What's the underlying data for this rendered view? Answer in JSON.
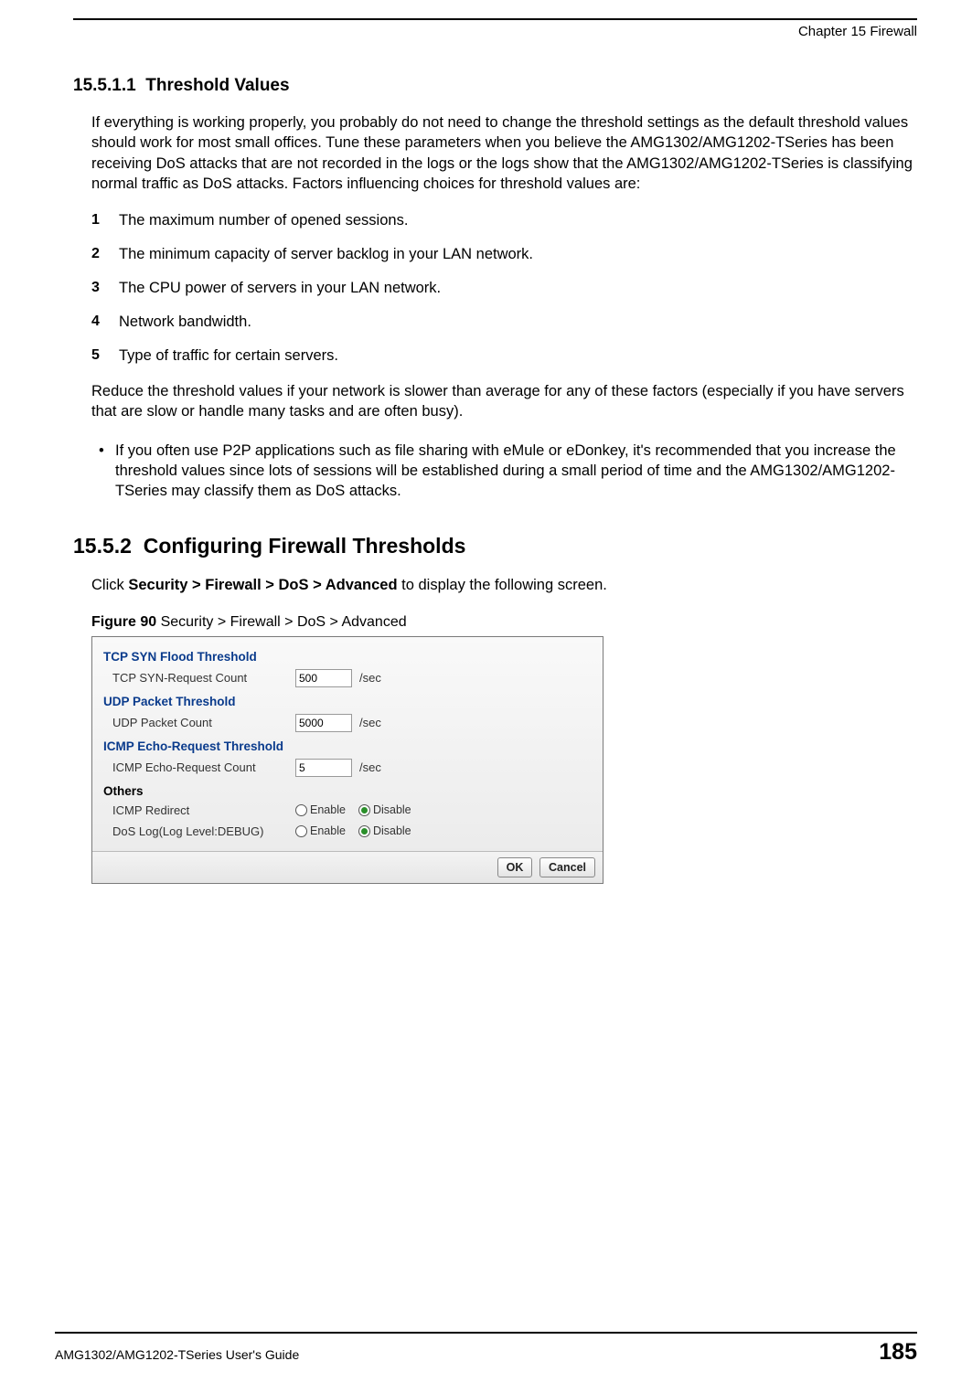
{
  "header": {
    "chapter": "Chapter 15 Firewall"
  },
  "sections": {
    "sub_num": "15.5.1.1",
    "sub_title": "Threshold Values",
    "intro": "If everything is working properly, you probably do not need to change the threshold settings as the default threshold values should work for most small offices. Tune these parameters when you believe the AMG1302/AMG1202-TSeries has been receiving DoS attacks that are not recorded in the logs or the logs show that the AMG1302/AMG1202-TSeries is classifying normal traffic as DoS attacks. Factors influencing choices for threshold values are:",
    "list": [
      {
        "n": "1",
        "t": "The maximum number of opened sessions."
      },
      {
        "n": "2",
        "t": "The minimum capacity of server backlog in your LAN network."
      },
      {
        "n": "3",
        "t": "The CPU power of servers in your LAN network."
      },
      {
        "n": "4",
        "t": "Network bandwidth."
      },
      {
        "n": "5",
        "t": "Type of traffic for certain servers."
      }
    ],
    "reduce": "Reduce the threshold values if your network is slower than average for any of these factors (especially if you have servers that are slow or handle many tasks and are often busy).",
    "bullet": "If you often use P2P applications such as file sharing with eMule or eDonkey, it's recommended that you increase the threshold values since lots of sessions will be established during a small period of time and the AMG1302/AMG1202-TSeries may classify them as DoS attacks.",
    "sec2_num": "15.5.2",
    "sec2_title": "Configuring Firewall Thresholds",
    "sec2_click_pre": "Click ",
    "sec2_click_path": "Security > Firewall > DoS > Advanced",
    "sec2_click_post": " to display the following screen.",
    "fig_label": "Figure 90",
    "fig_caption": "   Security > Firewall > DoS > Advanced"
  },
  "panel": {
    "grp1": "TCP SYN Flood Threshold",
    "r1_label": "TCP SYN-Request Count",
    "r1_value": "500",
    "r1_unit": "/sec",
    "grp2": "UDP Packet Threshold",
    "r2_label": "UDP Packet Count",
    "r2_value": "5000",
    "r2_unit": "/sec",
    "grp3": "ICMP Echo-Request Threshold",
    "r3_label": "ICMP Echo-Request Count",
    "r3_value": "5",
    "r3_unit": "/sec",
    "grp4": "Others",
    "r4_label": "ICMP Redirect",
    "r5_label": "DoS Log(Log Level:DEBUG)",
    "enable": "Enable",
    "disable": "Disable",
    "ok": "OK",
    "cancel": "Cancel"
  },
  "footer": {
    "guide": "AMG1302/AMG1202-TSeries User's Guide",
    "page": "185"
  }
}
